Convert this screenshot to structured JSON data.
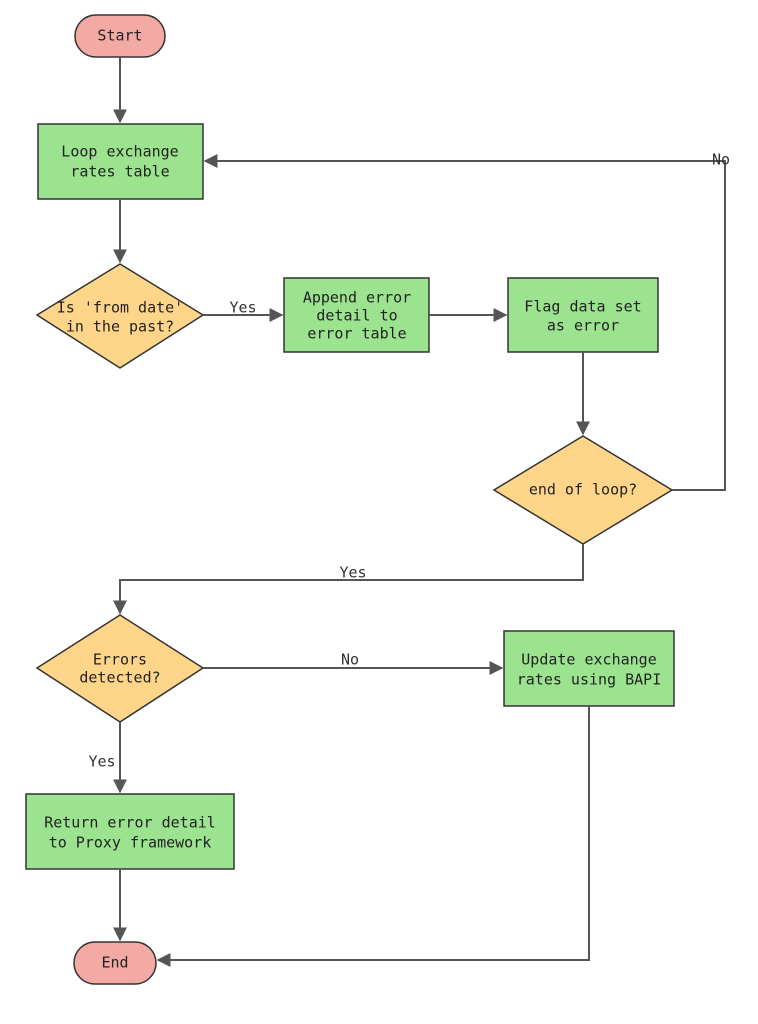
{
  "chart_data": {
    "type": "flowchart",
    "nodes": [
      {
        "id": "start",
        "type": "terminator",
        "label": "Start"
      },
      {
        "id": "loop",
        "type": "process",
        "label": "Loop exchange rates table"
      },
      {
        "id": "fromdate",
        "type": "decision",
        "label": "Is 'from date' in the past?"
      },
      {
        "id": "append",
        "type": "process",
        "label": "Append error detail to error table"
      },
      {
        "id": "flag",
        "type": "process",
        "label": "Flag data set as error"
      },
      {
        "id": "endloop",
        "type": "decision",
        "label": "end of loop?"
      },
      {
        "id": "errors",
        "type": "decision",
        "label": "Errors detected?"
      },
      {
        "id": "update",
        "type": "process",
        "label": "Update exchange rates using BAPI"
      },
      {
        "id": "return",
        "type": "process",
        "label": "Return error detail to Proxy framework"
      },
      {
        "id": "end",
        "type": "terminator",
        "label": "End"
      }
    ],
    "edges": [
      {
        "from": "start",
        "to": "loop",
        "label": ""
      },
      {
        "from": "loop",
        "to": "fromdate",
        "label": ""
      },
      {
        "from": "fromdate",
        "to": "append",
        "label": "Yes"
      },
      {
        "from": "append",
        "to": "flag",
        "label": ""
      },
      {
        "from": "flag",
        "to": "endloop",
        "label": ""
      },
      {
        "from": "endloop",
        "to": "loop",
        "label": "No"
      },
      {
        "from": "endloop",
        "to": "errors",
        "label": "Yes"
      },
      {
        "from": "errors",
        "to": "update",
        "label": "No"
      },
      {
        "from": "errors",
        "to": "return",
        "label": "Yes"
      },
      {
        "from": "return",
        "to": "end",
        "label": ""
      },
      {
        "from": "update",
        "to": "end",
        "label": ""
      }
    ]
  },
  "nodes": {
    "start": "Start",
    "loop1": "Loop exchange",
    "loop2": "rates table",
    "fromdate1": "Is 'from date'",
    "fromdate2": "in the past?",
    "append1": "Append error",
    "append2": "detail to",
    "append3": "error table",
    "flag1": "Flag data set",
    "flag2": "as error",
    "endloop": "end of loop?",
    "errors1": "Errors",
    "errors2": "detected?",
    "update1": "Update exchange",
    "update2": "rates using BAPI",
    "return1": "Return error detail",
    "return2": "to Proxy framework",
    "end": "End"
  },
  "labels": {
    "yes": "Yes",
    "no": "No"
  }
}
